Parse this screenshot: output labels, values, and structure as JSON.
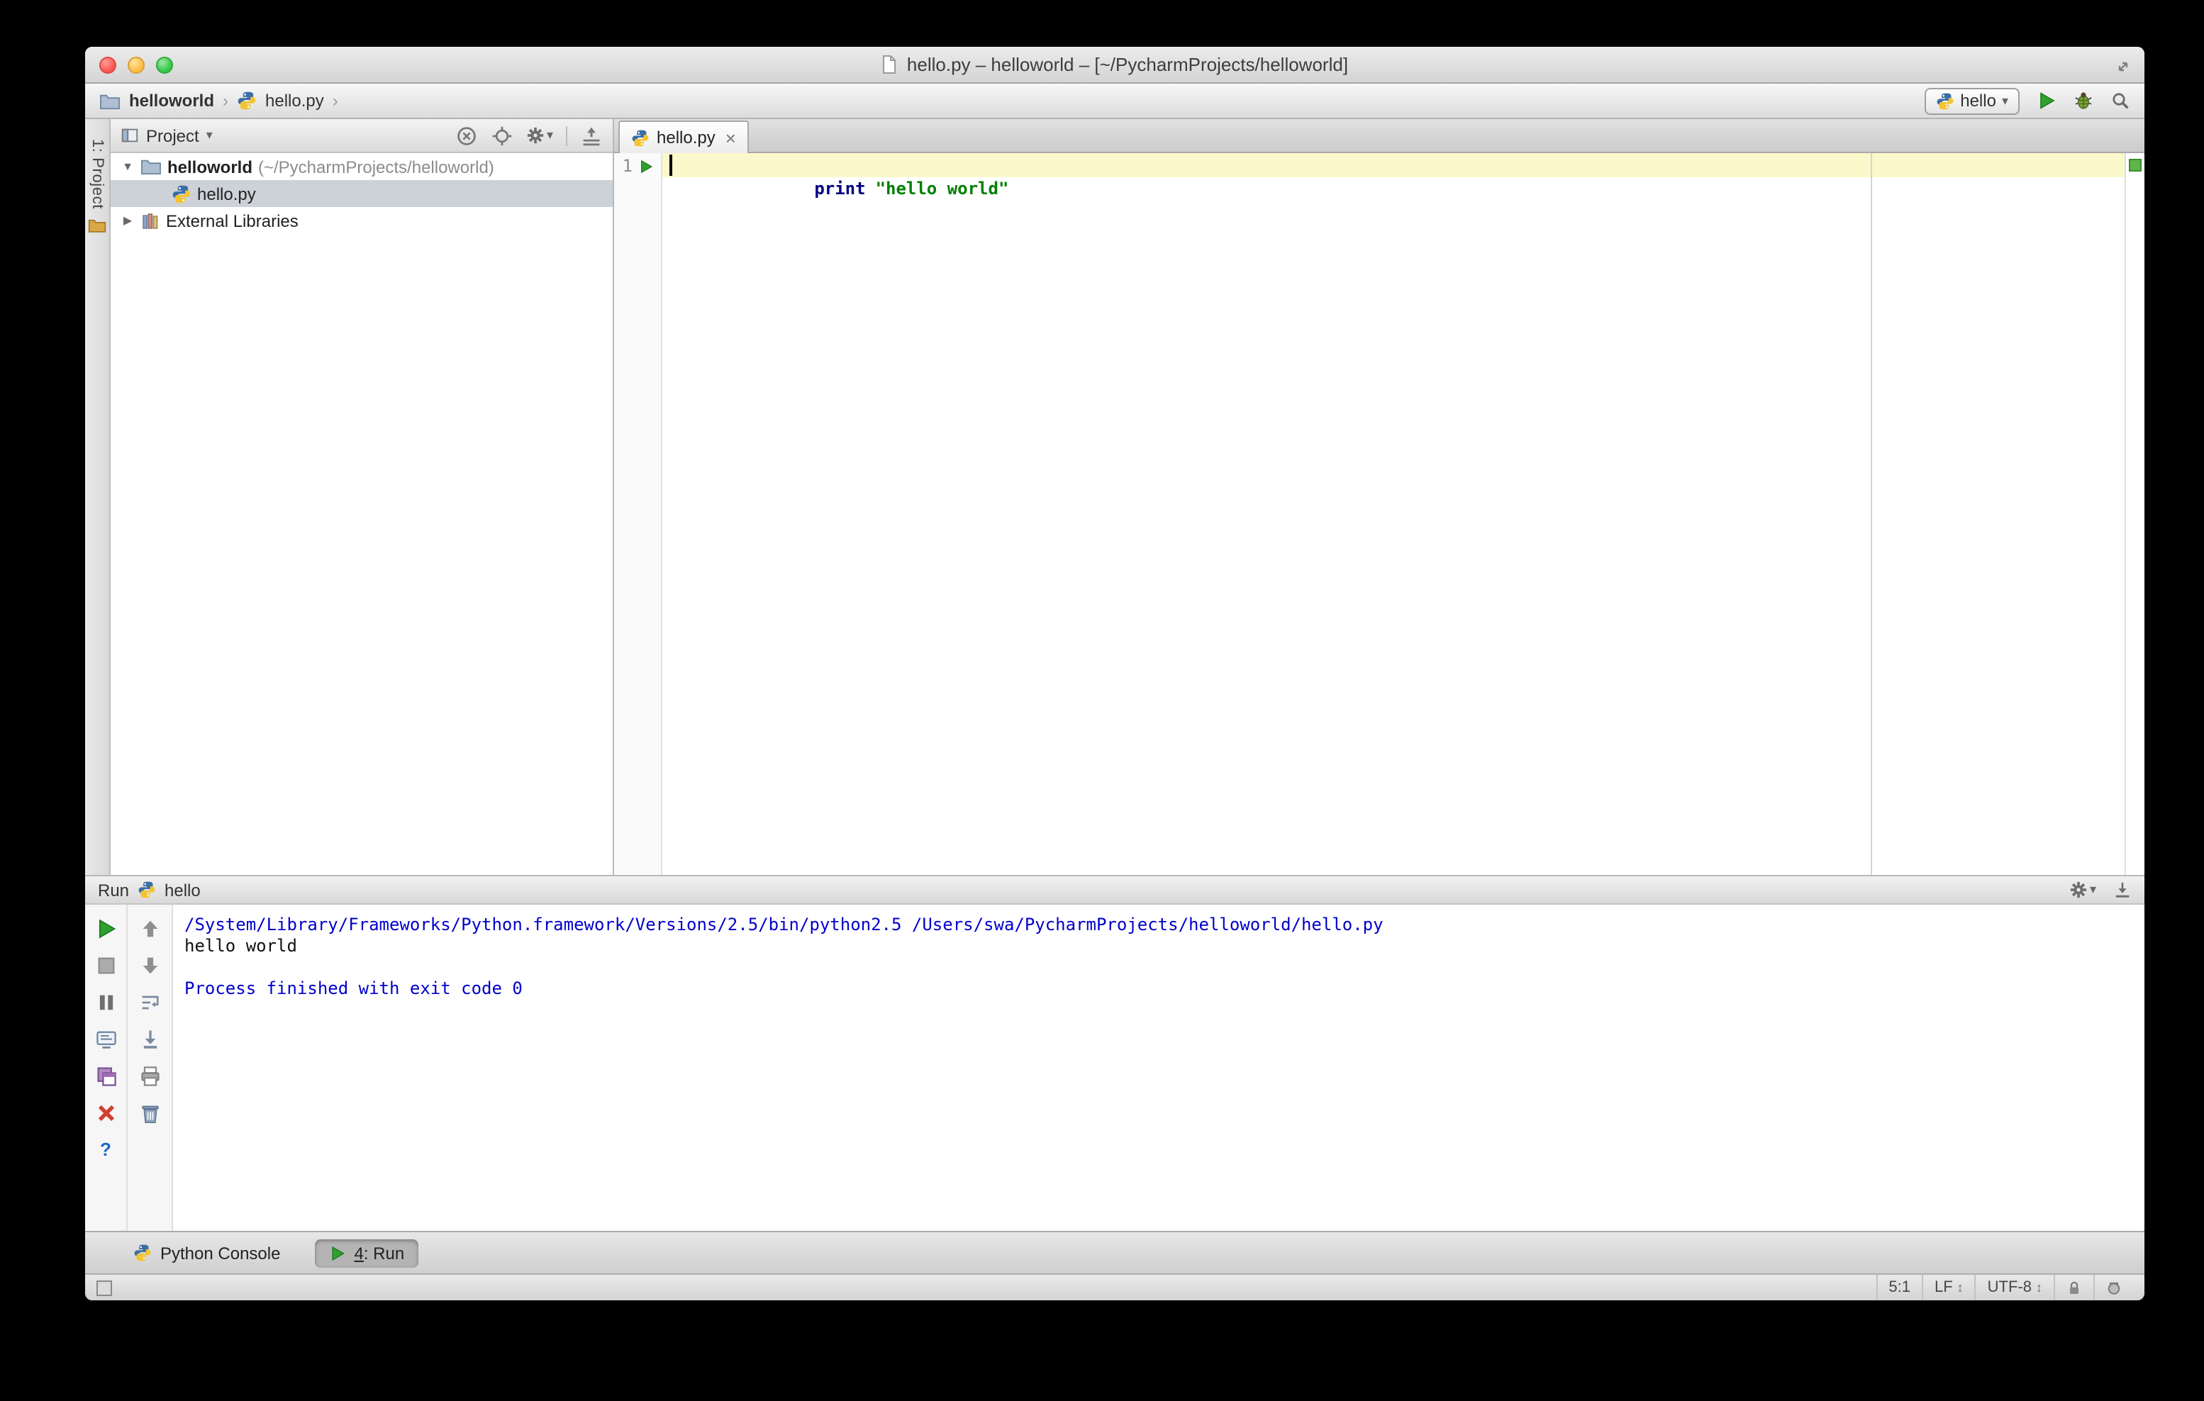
{
  "window": {
    "title": "hello.py – helloworld – [~/PycharmProjects/helloworld]"
  },
  "icons": {
    "chevron": "›",
    "dropdown_arrow": "▾",
    "close": "×",
    "tree_expanded": "▼",
    "tree_collapsed": "▶",
    "updown": "↕",
    "help": "?"
  },
  "navbar": {
    "breadcrumbs": [
      {
        "label": "helloworld"
      },
      {
        "label": "hello.py"
      }
    ],
    "run_config": {
      "label": "hello"
    }
  },
  "tool_stripe": {
    "project_button": "1: Project"
  },
  "project_panel": {
    "title": "Project",
    "tree": {
      "root_label": "helloworld",
      "root_path": "(~/PycharmProjects/helloworld)",
      "file": "hello.py",
      "external_libraries": "External Libraries"
    }
  },
  "editor": {
    "tab_label": "hello.py",
    "line_number": "1",
    "code_keyword": "print",
    "code_string": "\"hello world\""
  },
  "run_panel": {
    "title": "Run",
    "config_name": "hello",
    "console": [
      {
        "type": "system",
        "text": "/System/Library/Frameworks/Python.framework/Versions/2.5/bin/python2.5 /Users/swa/PycharmProjects/helloworld/hello.py"
      },
      {
        "type": "stdout",
        "text": "hello world"
      },
      {
        "type": "stdout",
        "text": ""
      },
      {
        "type": "system",
        "text": "Process finished with exit code 0"
      }
    ]
  },
  "toolwindow_bar": {
    "python_console": "Python Console",
    "run_number": "4",
    "run_suffix": ": Run"
  },
  "status_bar": {
    "caret_position": "5:1",
    "line_separator": "LF",
    "encoding": "UTF-8"
  }
}
